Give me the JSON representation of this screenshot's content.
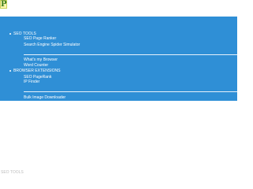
{
  "logo": {
    "letter": "P"
  },
  "menu": {
    "sections": [
      {
        "title": "SEO TOOLS",
        "items": [
          "SEO Page Ranker",
          "Search Engine Spider Simulator"
        ]
      },
      {
        "items": [
          "What's my Browser",
          "Word Counter"
        ]
      },
      {
        "title": "BROWSER EXTENSIONS",
        "items": [
          "SEO PageRank",
          "IP Finder"
        ]
      },
      {
        "items": [
          "Bulk Image Downloader"
        ]
      }
    ]
  },
  "footer": {
    "text": "SEO TOOLS"
  }
}
